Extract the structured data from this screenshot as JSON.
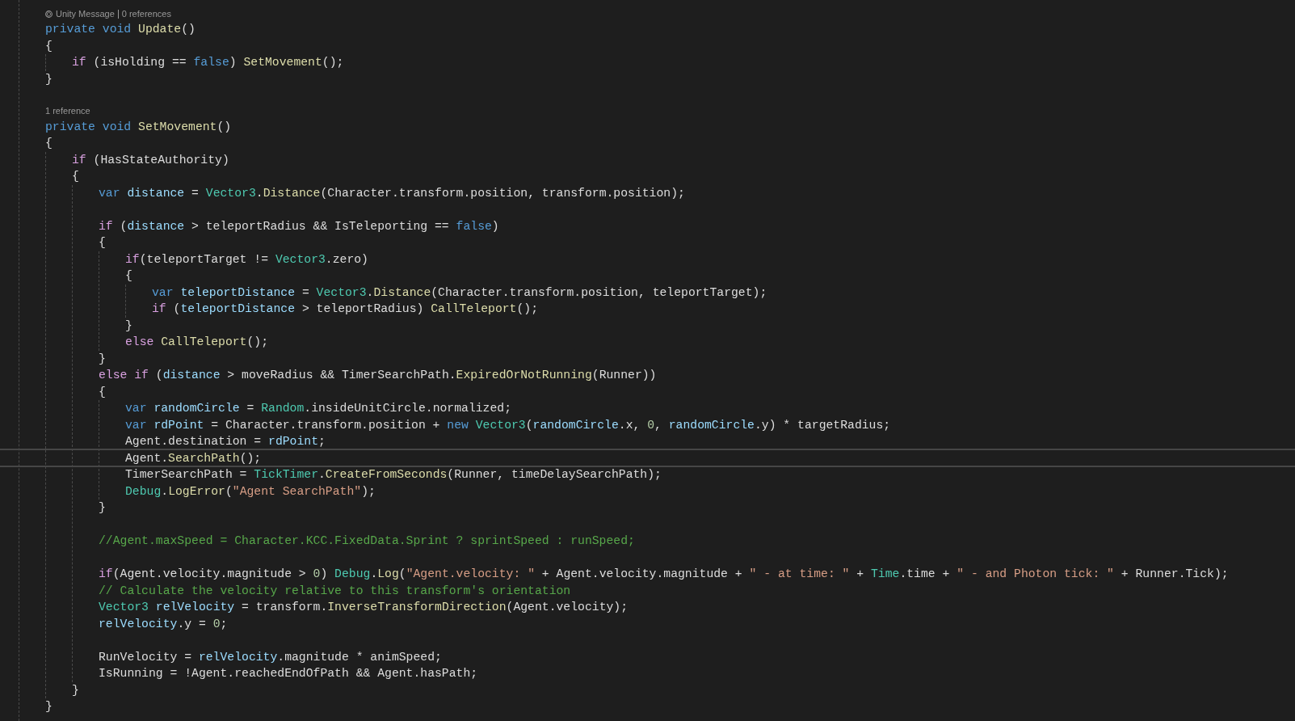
{
  "editor": {
    "items": [
      {
        "kind": "block",
        "children": [
          {
            "kind": "lens",
            "parts": [
              {
                "kind": "message",
                "text": "Unity Message"
              },
              {
                "kind": "references",
                "text": "0 references"
              }
            ]
          },
          {
            "kind": "line",
            "current": false,
            "tokens": [
              {
                "kind": "keyword",
                "text": "private void"
              },
              {
                "kind": "method",
                "text": " Update"
              },
              {
                "kind": "plain",
                "text": "()"
              }
            ]
          },
          {
            "kind": "line",
            "current": false,
            "tokens": [
              {
                "kind": "plain",
                "text": "{"
              }
            ]
          },
          {
            "kind": "block",
            "children": [
              {
                "kind": "line",
                "current": false,
                "tokens": [
                  {
                    "kind": "control",
                    "text": "if"
                  },
                  {
                    "kind": "plain",
                    "text": " (isHolding == "
                  },
                  {
                    "kind": "keyword",
                    "text": "false"
                  },
                  {
                    "kind": "plain",
                    "text": ") "
                  },
                  {
                    "kind": "method",
                    "text": "SetMovement"
                  },
                  {
                    "kind": "plain",
                    "text": "();"
                  }
                ]
              }
            ]
          },
          {
            "kind": "line",
            "current": false,
            "tokens": [
              {
                "kind": "plain",
                "text": "}"
              }
            ]
          },
          {
            "kind": "blank"
          },
          {
            "kind": "lens",
            "parts": [
              {
                "kind": "references",
                "text": "1 reference"
              }
            ]
          },
          {
            "kind": "line",
            "current": false,
            "tokens": [
              {
                "kind": "keyword",
                "text": "private void"
              },
              {
                "kind": "method",
                "text": " SetMovement"
              },
              {
                "kind": "plain",
                "text": "()"
              }
            ]
          },
          {
            "kind": "line",
            "current": false,
            "tokens": [
              {
                "kind": "plain",
                "text": "{"
              }
            ]
          },
          {
            "kind": "block",
            "children": [
              {
                "kind": "line",
                "current": false,
                "tokens": [
                  {
                    "kind": "control",
                    "text": "if"
                  },
                  {
                    "kind": "plain",
                    "text": " (HasStateAuthority)"
                  }
                ]
              },
              {
                "kind": "line",
                "current": false,
                "tokens": [
                  {
                    "kind": "plain",
                    "text": "{"
                  }
                ]
              },
              {
                "kind": "block",
                "children": [
                  {
                    "kind": "line",
                    "current": false,
                    "tokens": [
                      {
                        "kind": "keyword",
                        "text": "var"
                      },
                      {
                        "kind": "local",
                        "text": " distance"
                      },
                      {
                        "kind": "plain",
                        "text": " = "
                      },
                      {
                        "kind": "type",
                        "text": "Vector3"
                      },
                      {
                        "kind": "plain",
                        "text": "."
                      },
                      {
                        "kind": "method",
                        "text": "Distance"
                      },
                      {
                        "kind": "plain",
                        "text": "(Character.transform.position, transform.position);"
                      }
                    ]
                  },
                  {
                    "kind": "blank"
                  },
                  {
                    "kind": "line",
                    "current": false,
                    "tokens": [
                      {
                        "kind": "control",
                        "text": "if"
                      },
                      {
                        "kind": "plain",
                        "text": " ("
                      },
                      {
                        "kind": "local",
                        "text": "distance"
                      },
                      {
                        "kind": "plain",
                        "text": " > teleportRadius && IsTeleporting == "
                      },
                      {
                        "kind": "keyword",
                        "text": "false"
                      },
                      {
                        "kind": "plain",
                        "text": ")"
                      }
                    ]
                  },
                  {
                    "kind": "line",
                    "current": false,
                    "tokens": [
                      {
                        "kind": "plain",
                        "text": "{"
                      }
                    ]
                  },
                  {
                    "kind": "block",
                    "children": [
                      {
                        "kind": "line",
                        "current": false,
                        "tokens": [
                          {
                            "kind": "control",
                            "text": "if"
                          },
                          {
                            "kind": "plain",
                            "text": "(teleportTarget != "
                          },
                          {
                            "kind": "type",
                            "text": "Vector3"
                          },
                          {
                            "kind": "plain",
                            "text": ".zero)"
                          }
                        ]
                      },
                      {
                        "kind": "line",
                        "current": false,
                        "tokens": [
                          {
                            "kind": "plain",
                            "text": "{"
                          }
                        ]
                      },
                      {
                        "kind": "block",
                        "children": [
                          {
                            "kind": "line",
                            "current": false,
                            "tokens": [
                              {
                                "kind": "keyword",
                                "text": "var"
                              },
                              {
                                "kind": "local",
                                "text": " teleportDistance"
                              },
                              {
                                "kind": "plain",
                                "text": " = "
                              },
                              {
                                "kind": "type",
                                "text": "Vector3"
                              },
                              {
                                "kind": "plain",
                                "text": "."
                              },
                              {
                                "kind": "method",
                                "text": "Distance"
                              },
                              {
                                "kind": "plain",
                                "text": "(Character.transform.position, teleportTarget);"
                              }
                            ]
                          },
                          {
                            "kind": "line",
                            "current": false,
                            "tokens": [
                              {
                                "kind": "control",
                                "text": "if"
                              },
                              {
                                "kind": "plain",
                                "text": " ("
                              },
                              {
                                "kind": "local",
                                "text": "teleportDistance"
                              },
                              {
                                "kind": "plain",
                                "text": " > teleportRadius) "
                              },
                              {
                                "kind": "method",
                                "text": "CallTeleport"
                              },
                              {
                                "kind": "plain",
                                "text": "();"
                              }
                            ]
                          }
                        ]
                      },
                      {
                        "kind": "line",
                        "current": false,
                        "tokens": [
                          {
                            "kind": "plain",
                            "text": "}"
                          }
                        ]
                      },
                      {
                        "kind": "line",
                        "current": false,
                        "tokens": [
                          {
                            "kind": "control",
                            "text": "else"
                          },
                          {
                            "kind": "method",
                            "text": " CallTeleport"
                          },
                          {
                            "kind": "plain",
                            "text": "();"
                          }
                        ]
                      }
                    ]
                  },
                  {
                    "kind": "line",
                    "current": false,
                    "tokens": [
                      {
                        "kind": "plain",
                        "text": "}"
                      }
                    ]
                  },
                  {
                    "kind": "line",
                    "current": false,
                    "tokens": [
                      {
                        "kind": "control",
                        "text": "else if"
                      },
                      {
                        "kind": "plain",
                        "text": " ("
                      },
                      {
                        "kind": "local",
                        "text": "distance"
                      },
                      {
                        "kind": "plain",
                        "text": " > moveRadius && TimerSearchPath."
                      },
                      {
                        "kind": "method",
                        "text": "ExpiredOrNotRunning"
                      },
                      {
                        "kind": "plain",
                        "text": "(Runner))"
                      }
                    ]
                  },
                  {
                    "kind": "line",
                    "current": false,
                    "tokens": [
                      {
                        "kind": "plain",
                        "text": "{"
                      }
                    ]
                  },
                  {
                    "kind": "block",
                    "children": [
                      {
                        "kind": "line",
                        "current": false,
                        "tokens": [
                          {
                            "kind": "keyword",
                            "text": "var"
                          },
                          {
                            "kind": "local",
                            "text": " randomCircle"
                          },
                          {
                            "kind": "plain",
                            "text": " = "
                          },
                          {
                            "kind": "type",
                            "text": "Random"
                          },
                          {
                            "kind": "plain",
                            "text": ".insideUnitCircle.normalized;"
                          }
                        ]
                      },
                      {
                        "kind": "line",
                        "current": false,
                        "tokens": [
                          {
                            "kind": "keyword",
                            "text": "var"
                          },
                          {
                            "kind": "local",
                            "text": " rdPoint"
                          },
                          {
                            "kind": "plain",
                            "text": " = Character.transform.position + "
                          },
                          {
                            "kind": "keyword",
                            "text": "new"
                          },
                          {
                            "kind": "type",
                            "text": " Vector3"
                          },
                          {
                            "kind": "plain",
                            "text": "("
                          },
                          {
                            "kind": "local",
                            "text": "randomCircle"
                          },
                          {
                            "kind": "plain",
                            "text": ".x, "
                          },
                          {
                            "kind": "number",
                            "text": "0"
                          },
                          {
                            "kind": "plain",
                            "text": ", "
                          },
                          {
                            "kind": "local",
                            "text": "randomCircle"
                          },
                          {
                            "kind": "plain",
                            "text": ".y) * targetRadius;"
                          }
                        ]
                      },
                      {
                        "kind": "line",
                        "current": false,
                        "tokens": [
                          {
                            "kind": "plain",
                            "text": "Agent.destination = "
                          },
                          {
                            "kind": "local",
                            "text": "rdPoint"
                          },
                          {
                            "kind": "plain",
                            "text": ";"
                          }
                        ]
                      },
                      {
                        "kind": "line",
                        "current": true,
                        "tokens": [
                          {
                            "kind": "plain",
                            "text": "Agent."
                          },
                          {
                            "kind": "method",
                            "text": "SearchPath"
                          },
                          {
                            "kind": "plain",
                            "text": "();"
                          }
                        ]
                      },
                      {
                        "kind": "line",
                        "current": false,
                        "tokens": [
                          {
                            "kind": "plain",
                            "text": "TimerSearchPath = "
                          },
                          {
                            "kind": "type",
                            "text": "TickTimer"
                          },
                          {
                            "kind": "plain",
                            "text": "."
                          },
                          {
                            "kind": "method",
                            "text": "CreateFromSeconds"
                          },
                          {
                            "kind": "plain",
                            "text": "(Runner, timeDelaySearchPath);"
                          }
                        ]
                      },
                      {
                        "kind": "line",
                        "current": false,
                        "tokens": [
                          {
                            "kind": "type",
                            "text": "Debug"
                          },
                          {
                            "kind": "plain",
                            "text": "."
                          },
                          {
                            "kind": "method",
                            "text": "LogError"
                          },
                          {
                            "kind": "plain",
                            "text": "("
                          },
                          {
                            "kind": "string",
                            "text": "\"Agent SearchPath\""
                          },
                          {
                            "kind": "plain",
                            "text": ");"
                          }
                        ]
                      }
                    ]
                  },
                  {
                    "kind": "line",
                    "current": false,
                    "tokens": [
                      {
                        "kind": "plain",
                        "text": "}"
                      }
                    ]
                  },
                  {
                    "kind": "blank"
                  },
                  {
                    "kind": "line",
                    "current": false,
                    "tokens": [
                      {
                        "kind": "comment",
                        "text": "//Agent.maxSpeed = Character.KCC.FixedData.Sprint ? sprintSpeed : runSpeed;"
                      }
                    ]
                  },
                  {
                    "kind": "blank"
                  },
                  {
                    "kind": "line",
                    "current": false,
                    "tokens": [
                      {
                        "kind": "control",
                        "text": "if"
                      },
                      {
                        "kind": "plain",
                        "text": "(Agent.velocity.magnitude > "
                      },
                      {
                        "kind": "number",
                        "text": "0"
                      },
                      {
                        "kind": "plain",
                        "text": ") "
                      },
                      {
                        "kind": "type",
                        "text": "Debug"
                      },
                      {
                        "kind": "plain",
                        "text": "."
                      },
                      {
                        "kind": "method",
                        "text": "Log"
                      },
                      {
                        "kind": "plain",
                        "text": "("
                      },
                      {
                        "kind": "string",
                        "text": "\"Agent.velocity: \""
                      },
                      {
                        "kind": "plain",
                        "text": " + Agent.velocity.magnitude + "
                      },
                      {
                        "kind": "string",
                        "text": "\" - at time: \""
                      },
                      {
                        "kind": "plain",
                        "text": " + "
                      },
                      {
                        "kind": "type",
                        "text": "Time"
                      },
                      {
                        "kind": "plain",
                        "text": ".time + "
                      },
                      {
                        "kind": "string",
                        "text": "\" - and Photon tick: \""
                      },
                      {
                        "kind": "plain",
                        "text": " + Runner.Tick);"
                      }
                    ]
                  },
                  {
                    "kind": "line",
                    "current": false,
                    "tokens": [
                      {
                        "kind": "comment",
                        "text": "// Calculate the velocity relative to this transform's orientation"
                      }
                    ]
                  },
                  {
                    "kind": "line",
                    "current": false,
                    "tokens": [
                      {
                        "kind": "type",
                        "text": "Vector3"
                      },
                      {
                        "kind": "local",
                        "text": " relVelocity"
                      },
                      {
                        "kind": "plain",
                        "text": " = transform."
                      },
                      {
                        "kind": "method",
                        "text": "InverseTransformDirection"
                      },
                      {
                        "kind": "plain",
                        "text": "(Agent.velocity);"
                      }
                    ]
                  },
                  {
                    "kind": "line",
                    "current": false,
                    "tokens": [
                      {
                        "kind": "local",
                        "text": "relVelocity"
                      },
                      {
                        "kind": "plain",
                        "text": ".y = "
                      },
                      {
                        "kind": "number",
                        "text": "0"
                      },
                      {
                        "kind": "plain",
                        "text": ";"
                      }
                    ]
                  },
                  {
                    "kind": "blank"
                  },
                  {
                    "kind": "line",
                    "current": false,
                    "tokens": [
                      {
                        "kind": "plain",
                        "text": "RunVelocity = "
                      },
                      {
                        "kind": "local",
                        "text": "relVelocity"
                      },
                      {
                        "kind": "plain",
                        "text": ".magnitude * animSpeed;"
                      }
                    ]
                  },
                  {
                    "kind": "line",
                    "current": false,
                    "tokens": [
                      {
                        "kind": "plain",
                        "text": "IsRunning = !Agent.reachedEndOfPath && Agent.hasPath;"
                      }
                    ]
                  }
                ]
              },
              {
                "kind": "line",
                "current": false,
                "tokens": [
                  {
                    "kind": "plain",
                    "text": "}"
                  }
                ]
              }
            ]
          },
          {
            "kind": "line",
            "current": false,
            "tokens": [
              {
                "kind": "plain",
                "text": "}"
              }
            ]
          }
        ]
      }
    ]
  }
}
